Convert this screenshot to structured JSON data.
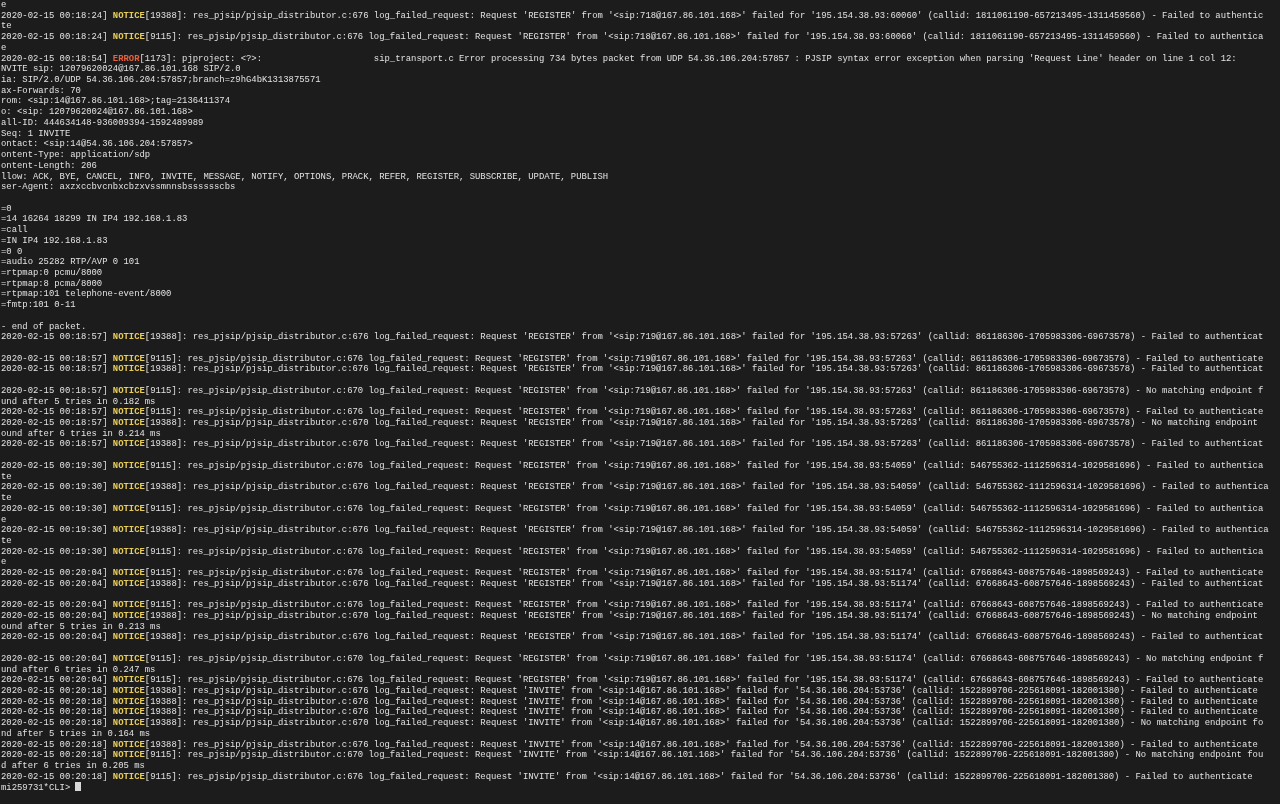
{
  "terminal": {
    "lines": [
      {
        "kind": "text",
        "text": "e"
      },
      {
        "kind": "log",
        "timestamp": "2020-02-15 00:18:24]",
        "tag": "NOTICE",
        "color": "#e8cd5a",
        "pid": "[19388]",
        "message": ": res_pjsip/pjsip_distributor.c:676 log_failed_request: Request 'REGISTER' from '<sip:718@167.86.101.168>' failed for '195.154.38.93:60060' (callid: 1811061190-657213495-1311459560) - Failed to authentic"
      },
      {
        "kind": "text",
        "text": "te"
      },
      {
        "kind": "log",
        "timestamp": "2020-02-15 00:18:24]",
        "tag": "NOTICE",
        "color": "#e8cd5a",
        "pid": "[9115]",
        "message": ": res_pjsip/pjsip_distributor.c:676 log_failed_request: Request 'REGISTER' from '<sip:718@167.86.101.168>' failed for '195.154.38.93:60060' (callid: 1811061190-657213495-1311459560) - Failed to authentica"
      },
      {
        "kind": "text",
        "text": "e"
      },
      {
        "kind": "log",
        "timestamp": "2020-02-15 00:18:54]",
        "tag": "ERROR",
        "color": "#e8603f",
        "pid": "[1173]",
        "message": ": pjproject: <?>:                     sip_transport.c Error processing 734 bytes packet from UDP 54.36.106.204:57857 : PJSIP syntax error exception when parsing 'Request Line' header on line 1 col 12:"
      },
      {
        "kind": "text",
        "text": "NVITE sip: 12079620024@167.86.101.168 SIP/2.0"
      },
      {
        "kind": "text",
        "text": "ia: SIP/2.0/UDP 54.36.106.204:57857;branch=z9hG4bK1313875571"
      },
      {
        "kind": "text",
        "text": "ax-Forwards: 70"
      },
      {
        "kind": "text",
        "text": "rom: <sip:14@167.86.101.168>;tag=2136411374"
      },
      {
        "kind": "text",
        "text": "o: <sip: 12079620024@167.86.101.168>"
      },
      {
        "kind": "text",
        "text": "all-ID: 444634148-936009394-1592489989"
      },
      {
        "kind": "text",
        "text": "Seq: 1 INVITE"
      },
      {
        "kind": "text",
        "text": "ontact: <sip:14@54.36.106.204:57857>"
      },
      {
        "kind": "text",
        "text": "ontent-Type: application/sdp"
      },
      {
        "kind": "text",
        "text": "ontent-Length: 206"
      },
      {
        "kind": "text",
        "text": "llow: ACK, BYE, CANCEL, INFO, INVITE, MESSAGE, NOTIFY, OPTIONS, PRACK, REFER, REGISTER, SUBSCRIBE, UPDATE, PUBLISH"
      },
      {
        "kind": "text",
        "text": "ser-Agent: axzxccbvcnbxcbzxvssmnnsbsssssscbs"
      },
      {
        "kind": "blank"
      },
      {
        "kind": "text",
        "text": "=0"
      },
      {
        "kind": "text",
        "text": "=14 16264 18299 IN IP4 192.168.1.83"
      },
      {
        "kind": "text",
        "text": "=call"
      },
      {
        "kind": "text",
        "text": "=IN IP4 192.168.1.83"
      },
      {
        "kind": "text",
        "text": "=0 0"
      },
      {
        "kind": "text",
        "text": "=audio 25282 RTP/AVP 0 101"
      },
      {
        "kind": "text",
        "text": "=rtpmap:0 pcmu/8000"
      },
      {
        "kind": "text",
        "text": "=rtpmap:8 pcma/8000"
      },
      {
        "kind": "text",
        "text": "=rtpmap:101 telephone-event/8000"
      },
      {
        "kind": "text",
        "text": "=fmtp:101 0-11"
      },
      {
        "kind": "blank"
      },
      {
        "kind": "text",
        "text": "- end of packet."
      },
      {
        "kind": "log",
        "timestamp": "2020-02-15 00:18:57]",
        "tag": "NOTICE",
        "color": "#e8cd5a",
        "pid": "[19388]",
        "message": ": res_pjsip/pjsip_distributor.c:676 log_failed_request: Request 'REGISTER' from '<sip:719@167.86.101.168>' failed for '195.154.38.93:57263' (callid: 861186306-1705983306-69673578) - Failed to authenticat"
      },
      {
        "kind": "blank"
      },
      {
        "kind": "log",
        "timestamp": "2020-02-15 00:18:57]",
        "tag": "NOTICE",
        "color": "#e8cd5a",
        "pid": "[9115]",
        "message": ": res_pjsip/pjsip_distributor.c:676 log_failed_request: Request 'REGISTER' from '<sip:719@167.86.101.168>' failed for '195.154.38.93:57263' (callid: 861186306-1705983306-69673578) - Failed to authenticate"
      },
      {
        "kind": "log",
        "timestamp": "2020-02-15 00:18:57]",
        "tag": "NOTICE",
        "color": "#e8cd5a",
        "pid": "[19388]",
        "message": ": res_pjsip/pjsip_distributor.c:676 log_failed_request: Request 'REGISTER' from '<sip:719@167.86.101.168>' failed for '195.154.38.93:57263' (callid: 861186306-1705983306-69673578) - Failed to authenticat"
      },
      {
        "kind": "blank"
      },
      {
        "kind": "log",
        "timestamp": "2020-02-15 00:18:57]",
        "tag": "NOTICE",
        "color": "#e8cd5a",
        "pid": "[9115]",
        "message": ": res_pjsip/pjsip_distributor.c:670 log_failed_request: Request 'REGISTER' from '<sip:719@167.86.101.168>' failed for '195.154.38.93:57263' (callid: 861186306-1705983306-69673578) - No matching endpoint f"
      },
      {
        "kind": "text",
        "text": "und after 5 tries in 0.182 ms"
      },
      {
        "kind": "log",
        "timestamp": "2020-02-15 00:18:57]",
        "tag": "NOTICE",
        "color": "#e8cd5a",
        "pid": "[9115]",
        "message": ": res_pjsip/pjsip_distributor.c:676 log_failed_request: Request 'REGISTER' from '<sip:719@167.86.101.168>' failed for '195.154.38.93:57263' (callid: 861186306-1705983306-69673578) - Failed to authenticate"
      },
      {
        "kind": "log",
        "timestamp": "2020-02-15 00:18:57]",
        "tag": "NOTICE",
        "color": "#e8cd5a",
        "pid": "[19388]",
        "message": ": res_pjsip/pjsip_distributor.c:670 log_failed_request: Request 'REGISTER' from '<sip:719@167.86.101.168>' failed for '195.154.38.93:57263' (callid: 861186306-1705983306-69673578) - No matching endpoint"
      },
      {
        "kind": "text",
        "text": "ound after 6 tries in 0.214 ms"
      },
      {
        "kind": "log",
        "timestamp": "2020-02-15 00:18:57]",
        "tag": "NOTICE",
        "color": "#e8cd5a",
        "pid": "[19388]",
        "message": ": res_pjsip/pjsip_distributor.c:676 log_failed_request: Request 'REGISTER' from '<sip:719@167.86.101.168>' failed for '195.154.38.93:57263' (callid: 861186306-1705983306-69673578) - Failed to authenticat"
      },
      {
        "kind": "blank"
      },
      {
        "kind": "log",
        "timestamp": "2020-02-15 00:19:30]",
        "tag": "NOTICE",
        "color": "#e8cd5a",
        "pid": "[9115]",
        "message": ": res_pjsip/pjsip_distributor.c:676 log_failed_request: Request 'REGISTER' from '<sip:719@167.86.101.168>' failed for '195.154.38.93:54059' (callid: 546755362-1112596314-1029581696) - Failed to authentica"
      },
      {
        "kind": "text",
        "text": "te"
      },
      {
        "kind": "log",
        "timestamp": "2020-02-15 00:19:30]",
        "tag": "NOTICE",
        "color": "#e8cd5a",
        "pid": "[19388]",
        "message": ": res_pjsip/pjsip_distributor.c:676 log_failed_request: Request 'REGISTER' from '<sip:719@167.86.101.168>' failed for '195.154.38.93:54059' (callid: 546755362-1112596314-1029581696) - Failed to authentica"
      },
      {
        "kind": "text",
        "text": "te"
      },
      {
        "kind": "log",
        "timestamp": "2020-02-15 00:19:30]",
        "tag": "NOTICE",
        "color": "#e8cd5a",
        "pid": "[9115]",
        "message": ": res_pjsip/pjsip_distributor.c:676 log_failed_request: Request 'REGISTER' from '<sip:719@167.86.101.168>' failed for '195.154.38.93:54059' (callid: 546755362-1112596314-1029581696) - Failed to authentica"
      },
      {
        "kind": "text",
        "text": "e"
      },
      {
        "kind": "log",
        "timestamp": "2020-02-15 00:19:30]",
        "tag": "NOTICE",
        "color": "#e8cd5a",
        "pid": "[19388]",
        "message": ": res_pjsip/pjsip_distributor.c:676 log_failed_request: Request 'REGISTER' from '<sip:719@167.86.101.168>' failed for '195.154.38.93:54059' (callid: 546755362-1112596314-1029581696) - Failed to authentica"
      },
      {
        "kind": "text",
        "text": "te"
      },
      {
        "kind": "log",
        "timestamp": "2020-02-15 00:19:30]",
        "tag": "NOTICE",
        "color": "#e8cd5a",
        "pid": "[9115]",
        "message": ": res_pjsip/pjsip_distributor.c:676 log_failed_request: Request 'REGISTER' from '<sip:719@167.86.101.168>' failed for '195.154.38.93:54059' (callid: 546755362-1112596314-1029581696) - Failed to authentica"
      },
      {
        "kind": "text",
        "text": "e"
      },
      {
        "kind": "log",
        "timestamp": "2020-02-15 00:20:04]",
        "tag": "NOTICE",
        "color": "#e8cd5a",
        "pid": "[9115]",
        "message": ": res_pjsip/pjsip_distributor.c:676 log_failed_request: Request 'REGISTER' from '<sip:719@167.86.101.168>' failed for '195.154.38.93:51174' (callid: 67668643-608757646-1898569243) - Failed to authenticate"
      },
      {
        "kind": "log",
        "timestamp": "2020-02-15 00:20:04]",
        "tag": "NOTICE",
        "color": "#e8cd5a",
        "pid": "[19388]",
        "message": ": res_pjsip/pjsip_distributor.c:676 log_failed_request: Request 'REGISTER' from '<sip:719@167.86.101.168>' failed for '195.154.38.93:51174' (callid: 67668643-608757646-1898569243) - Failed to authenticat"
      },
      {
        "kind": "blank"
      },
      {
        "kind": "log",
        "timestamp": "2020-02-15 00:20:04]",
        "tag": "NOTICE",
        "color": "#e8cd5a",
        "pid": "[9115]",
        "message": ": res_pjsip/pjsip_distributor.c:676 log_failed_request: Request 'REGISTER' from '<sip:719@167.86.101.168>' failed for '195.154.38.93:51174' (callid: 67668643-608757646-1898569243) - Failed to authenticate"
      },
      {
        "kind": "log",
        "timestamp": "2020-02-15 00:20:04]",
        "tag": "NOTICE",
        "color": "#e8cd5a",
        "pid": "[19388]",
        "message": ": res_pjsip/pjsip_distributor.c:670 log_failed_request: Request 'REGISTER' from '<sip:719@167.86.101.168>' failed for '195.154.38.93:51174' (callid: 67668643-608757646-1898569243) - No matching endpoint"
      },
      {
        "kind": "text",
        "text": "ound after 5 tries in 0.213 ms"
      },
      {
        "kind": "log",
        "timestamp": "2020-02-15 00:20:04]",
        "tag": "NOTICE",
        "color": "#e8cd5a",
        "pid": "[19388]",
        "message": ": res_pjsip/pjsip_distributor.c:676 log_failed_request: Request 'REGISTER' from '<sip:719@167.86.101.168>' failed for '195.154.38.93:51174' (callid: 67668643-608757646-1898569243) - Failed to authenticat"
      },
      {
        "kind": "blank"
      },
      {
        "kind": "log",
        "timestamp": "2020-02-15 00:20:04]",
        "tag": "NOTICE",
        "color": "#e8cd5a",
        "pid": "[9115]",
        "message": ": res_pjsip/pjsip_distributor.c:670 log_failed_request: Request 'REGISTER' from '<sip:719@167.86.101.168>' failed for '195.154.38.93:51174' (callid: 67668643-608757646-1898569243) - No matching endpoint f"
      },
      {
        "kind": "text",
        "text": "und after 6 tries in 0.247 ms"
      },
      {
        "kind": "log",
        "timestamp": "2020-02-15 00:20:04]",
        "tag": "NOTICE",
        "color": "#e8cd5a",
        "pid": "[9115]",
        "message": ": res_pjsip/pjsip_distributor.c:676 log_failed_request: Request 'REGISTER' from '<sip:719@167.86.101.168>' failed for '195.154.38.93:51174' (callid: 67668643-608757646-1898569243) - Failed to authenticate"
      },
      {
        "kind": "log",
        "timestamp": "2020-02-15 00:20:18]",
        "tag": "NOTICE",
        "color": "#e8cd5a",
        "pid": "[19388]",
        "message": ": res_pjsip/pjsip_distributor.c:676 log_failed_request: Request 'INVITE' from '<sip:14@167.86.101.168>' failed for '54.36.106.204:53736' (callid: 1522899706-225618091-182001380) - Failed to authenticate"
      },
      {
        "kind": "log",
        "timestamp": "2020-02-15 00:20:18]",
        "tag": "NOTICE",
        "color": "#e8cd5a",
        "pid": "[19388]",
        "message": ": res_pjsip/pjsip_distributor.c:676 log_failed_request: Request 'INVITE' from '<sip:14@167.86.101.168>' failed for '54.36.106.204:53736' (callid: 1522899706-225618091-182001380) - Failed to authenticate"
      },
      {
        "kind": "log",
        "timestamp": "2020-02-15 00:20:18]",
        "tag": "NOTICE",
        "color": "#e8cd5a",
        "pid": "[19388]",
        "message": ": res_pjsip/pjsip_distributor.c:676 log_failed_request: Request 'INVITE' from '<sip:14@167.86.101.168>' failed for '54.36.106.204:53736' (callid: 1522899706-225618091-182001380) - Failed to authenticate"
      },
      {
        "kind": "log",
        "timestamp": "2020-02-15 00:20:18]",
        "tag": "NOTICE",
        "color": "#e8cd5a",
        "pid": "[19388]",
        "message": ": res_pjsip/pjsip_distributor.c:670 log_failed_request: Request 'INVITE' from '<sip:14@167.86.101.168>' failed for '54.36.106.204:53736' (callid: 1522899706-225618091-182001380) - No matching endpoint fo"
      },
      {
        "kind": "text",
        "text": "nd after 5 tries in 0.164 ms"
      },
      {
        "kind": "log",
        "timestamp": "2020-02-15 00:20:18]",
        "tag": "NOTICE",
        "color": "#e8cd5a",
        "pid": "[19388]",
        "message": ": res_pjsip/pjsip_distributor.c:676 log_failed_request: Request 'INVITE' from '<sip:14@167.86.101.168>' failed for '54.36.106.204:53736' (callid: 1522899706-225618091-182001380) - Failed to authenticate"
      },
      {
        "kind": "log",
        "timestamp": "2020-02-15 00:20:18]",
        "tag": "NOTICE",
        "color": "#e8cd5a",
        "pid": "[9115]",
        "message": ": res_pjsip/pjsip_distributor.c:670 log_failed_request: Request 'INVITE' from '<sip:14@167.86.101.168>' failed for '54.36.106.204:53736' (callid: 1522899706-225618091-182001380) - No matching endpoint fou"
      },
      {
        "kind": "text",
        "text": "d after 6 tries in 0.205 ms"
      },
      {
        "kind": "log",
        "timestamp": "2020-02-15 00:20:18]",
        "tag": "NOTICE",
        "color": "#e8cd5a",
        "pid": "[9115]",
        "message": ": res_pjsip/pjsip_distributor.c:676 log_failed_request: Request 'INVITE' from '<sip:14@167.86.101.168>' failed for '54.36.106.204:53736' (callid: 1522899706-225618091-182001380) - Failed to authenticate"
      },
      {
        "kind": "prompt",
        "text": "mi259731*CLI>"
      }
    ]
  }
}
